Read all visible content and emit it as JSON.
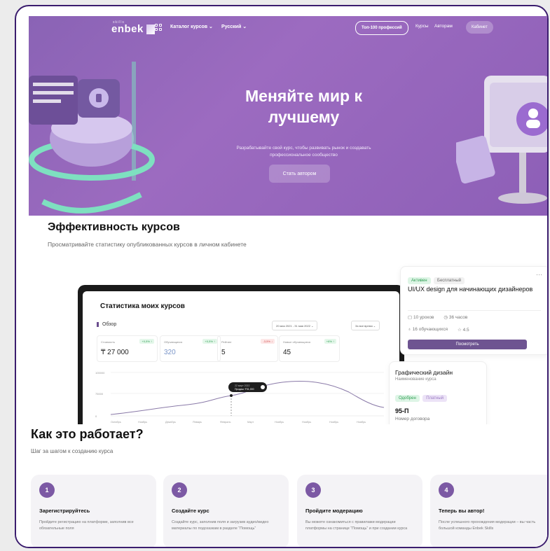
{
  "nav": {
    "logo_small": "skills",
    "logo_text": "enbek",
    "catalog": "Каталог курсов ⌄",
    "language": "Русский ⌄",
    "top100": "Топ-100 профессий",
    "courses": "Курсы",
    "authors": "Авторам",
    "cabinet": "Кабинет"
  },
  "hero": {
    "title": "Меняйте мир к лучшему",
    "subtitle": "Разрабатывайте свой курс, чтобы развивать рынок и создавать профессиональное сообщество",
    "button": "Стать автором"
  },
  "efficiency": {
    "title": "Эффективность курсов",
    "subtitle": "Просматривайте статистику опубликованных курсов в личном кабинете"
  },
  "dashboard": {
    "title": "Статистика моих курсов",
    "overview": "Обзор",
    "date_range": "20 мая 2021 - 31 мая 2022 ⌄",
    "period": "За все время ⌄",
    "stats": [
      {
        "label": "Стоимость",
        "badge": "+0,5% ↑",
        "value": "₸ 27 000",
        "badge_color": "#e4f7ea",
        "badge_text": "#2f9e53",
        "value_color": "#222"
      },
      {
        "label": "Обучающихся",
        "badge": "+0,5% ↑",
        "value": "320",
        "badge_color": "#e4f7ea",
        "badge_text": "#2f9e53",
        "value_color": "#7a95c8"
      },
      {
        "label": "Рейтинг",
        "badge": "-3,5% ↓",
        "value": "5",
        "badge_color": "#fde7e7",
        "badge_text": "#d04c4c",
        "value_color": "#222"
      },
      {
        "label": "Новые обучающиеся",
        "badge": "+6% ↑",
        "value": "45",
        "badge_color": "#e4f7ea",
        "badge_text": "#2f9e53",
        "value_color": "#222"
      }
    ],
    "chart": {
      "y_ticks": [
        "100000",
        "75000",
        "0"
      ],
      "x_ticks": [
        "Октябрь",
        "Ноябрь",
        "Декабрь",
        "Январь",
        "Февраль",
        "Март",
        "Ноябрь",
        "Ноябрь",
        "Ноябрь",
        "Ноябрь"
      ],
      "tooltip_date": "22 март 2022",
      "tooltip_value": "Продаж: ₸31,000"
    }
  },
  "course_card": {
    "status": "Активен",
    "type": "Бесплатный",
    "more": "···",
    "title": "UI/UX design для начинающих дизайнеров",
    "lessons": "10 уроков",
    "hours": "36 часов",
    "students": "16 обучающихся",
    "rating": "4.5",
    "button": "Посмотреть"
  },
  "course_card2": {
    "title": "Графический дизайн",
    "subtitle": "Наименование курса",
    "status": "Одобрен",
    "type": "Платный",
    "contract": "95-П",
    "contract_label": "Номер договора"
  },
  "how": {
    "title": "Как это работает?",
    "subtitle": "Шаг за шагом к созданию курса",
    "steps": [
      {
        "num": "1",
        "title": "Зарегистрируйтесь",
        "text": "Пройдите регистрацию на платформе, заполнив все обязательные поля"
      },
      {
        "num": "2",
        "title": "Создайте курс",
        "text": "Создайте курс, заполнив поля и загрузив аудио/видео материалы по подсказкам в разделе “Помощь”"
      },
      {
        "num": "3",
        "title": "Пройдите модерацию",
        "text": "Вы можете ознакомиться с правилами модерации платформы на странице “Помощь” и при создании курса"
      },
      {
        "num": "4",
        "title": "Теперь вы автор!",
        "text": "После успешного прохождения модерации – вы часть большой команды Enbek Skills"
      }
    ]
  },
  "colors": {
    "brand": "#7c59a4",
    "hero": "#9266bd",
    "active_green": "#2f9e53"
  }
}
